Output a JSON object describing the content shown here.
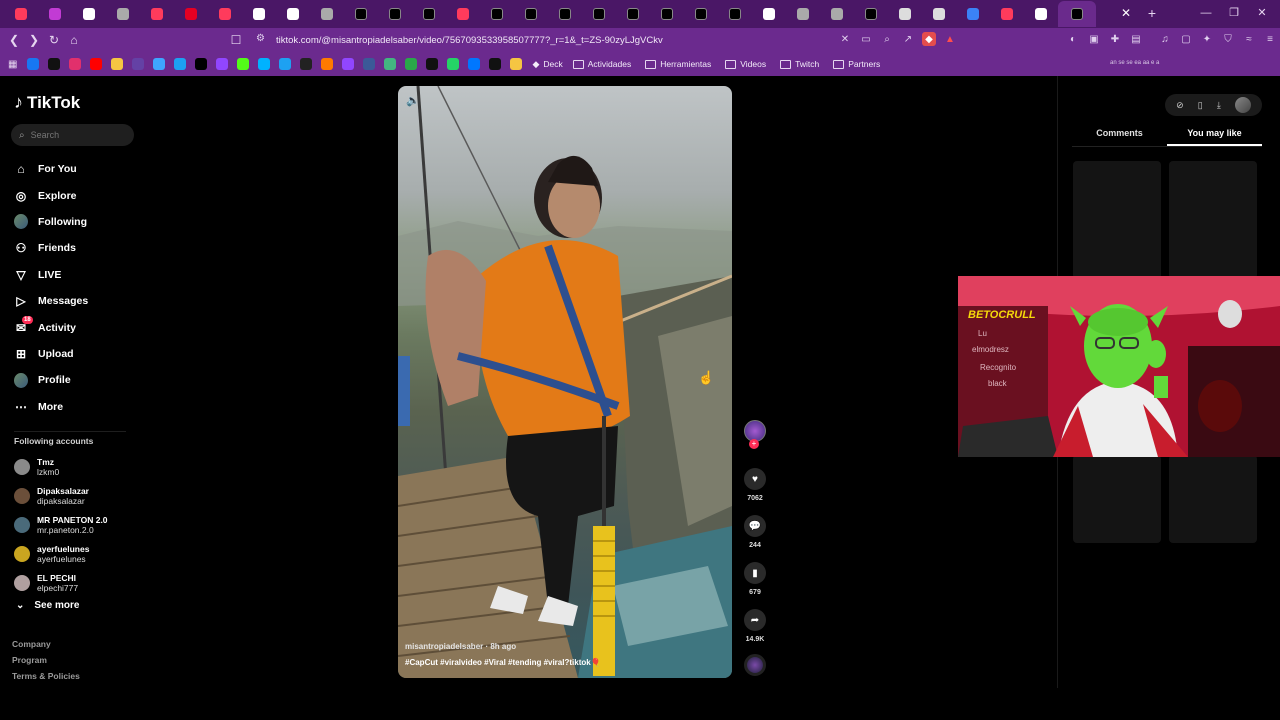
{
  "browser": {
    "url": "tiktok.com/@misantropiadelsaber/video/7567093533958507777?_r=1&_t=ZS-90zyLJgVCkv",
    "tabs": [
      {
        "color": "#ff3b5c",
        "icon": "youtube-icon"
      },
      {
        "color": "#c23bd4",
        "icon": "mail-icon"
      },
      {
        "color": "#ffffff",
        "icon": "chrome-icon"
      },
      {
        "color": "#aaaaaa",
        "icon": "settings-icon"
      },
      {
        "color": "#ff3b5c",
        "icon": "youtube-icon"
      },
      {
        "color": "#e60023",
        "icon": "pinterest-icon"
      },
      {
        "color": "#ff3b5c",
        "icon": "youtube-icon"
      },
      {
        "color": "#ffffff",
        "icon": "chrome-icon"
      },
      {
        "color": "#ffffff",
        "icon": "chrome-icon"
      },
      {
        "color": "#aaaaaa",
        "icon": "settings-icon"
      },
      {
        "color": "#000000",
        "icon": "tiktok-icon"
      },
      {
        "color": "#000000",
        "icon": "tiktok-icon"
      },
      {
        "color": "#000000",
        "icon": "tiktok-icon"
      },
      {
        "color": "#ff3b5c",
        "icon": "youtube-icon"
      },
      {
        "color": "#000000",
        "icon": "tiktok-icon"
      },
      {
        "color": "#000000",
        "icon": "tiktok-icon"
      },
      {
        "color": "#000000",
        "icon": "tiktok-icon"
      },
      {
        "color": "#000000",
        "icon": "tiktok-icon"
      },
      {
        "color": "#000000",
        "icon": "tiktok-icon"
      },
      {
        "color": "#000000",
        "icon": "tiktok-icon"
      },
      {
        "color": "#000000",
        "icon": "tiktok-icon"
      },
      {
        "color": "#000000",
        "icon": "tiktok-icon"
      },
      {
        "color": "#ffffff",
        "icon": "chrome-icon"
      },
      {
        "color": "#aaaaaa",
        "icon": "settings-icon"
      },
      {
        "color": "#aaaaaa",
        "icon": "settings-icon"
      },
      {
        "color": "#000000",
        "icon": "tiktok-icon"
      },
      {
        "color": "#dddddd",
        "icon": "page-icon"
      },
      {
        "color": "#dddddd",
        "icon": "page-icon"
      },
      {
        "color": "#3b82f6",
        "icon": "check-icon"
      },
      {
        "color": "#ff3b5c",
        "icon": "youtube-icon"
      },
      {
        "color": "#ffffff",
        "icon": "chrome-icon"
      },
      {
        "color": "#000000",
        "icon": "tiktok-icon"
      }
    ],
    "bookmarks": {
      "icons": [
        "#1877f2",
        "#111111",
        "#e1306c",
        "#ff0000",
        "#f5c542",
        "#6441a5",
        "#3ea6ff",
        "#1da1f2",
        "#000000",
        "#9146ff",
        "#53fc18",
        "#00b2ff",
        "#1da1f2",
        "#222222",
        "#ff7a00",
        "#9146ff",
        "#3b5998",
        "#43b581",
        "#2aa84a",
        "#111111",
        "#25d366",
        "#0077ff",
        "#111111",
        "#f5c542"
      ],
      "deck": "Deck",
      "folders": [
        "Actividades",
        "Herramientas",
        "Videos",
        "Twitch",
        "Partners"
      ],
      "status": "an se se ea aa e a"
    }
  },
  "sidebar": {
    "logo": "TikTok",
    "search_placeholder": "Search",
    "nav": [
      {
        "label": "For You",
        "icon": "home-icon"
      },
      {
        "label": "Explore",
        "icon": "compass-icon"
      },
      {
        "label": "Following",
        "icon": "avatar-icon"
      },
      {
        "label": "Friends",
        "icon": "friends-icon"
      },
      {
        "label": "LIVE",
        "icon": "live-icon"
      },
      {
        "label": "Messages",
        "icon": "messages-icon"
      },
      {
        "label": "Activity",
        "icon": "activity-icon",
        "badge": "18"
      },
      {
        "label": "Upload",
        "icon": "upload-icon"
      },
      {
        "label": "Profile",
        "icon": "profile-icon"
      },
      {
        "label": "More",
        "icon": "more-icon"
      }
    ],
    "following_title": "Following accounts",
    "accounts": [
      {
        "name": "Tmz",
        "user": "lzkm0",
        "color": "#8a8a8a"
      },
      {
        "name": "Dipaksalazar",
        "user": "dipaksalazar",
        "color": "#6b4f3a"
      },
      {
        "name": "MR PANETON 2.0",
        "user": "mr.paneton.2.0",
        "color": "#4a6a7a"
      },
      {
        "name": "ayerfuelunes",
        "user": "ayerfuelunes",
        "color": "#c9a520"
      },
      {
        "name": "EL PECHI",
        "user": "elpechi777",
        "color": "#b0a0a0"
      }
    ],
    "see_more": "See more",
    "footer": [
      "Company",
      "Program",
      "Terms & Policies"
    ]
  },
  "video": {
    "author": "misantropiadelsaber",
    "time": "8h ago",
    "meta_sep": " · ",
    "hashtags": "#CapCut #viralvideo #Viral #tending #viral?tiktok🎈",
    "likes": "7062",
    "comments": "244",
    "saves": "679",
    "shares": "14.9K"
  },
  "right_panel": {
    "tabs": [
      "Comments",
      "You may like"
    ],
    "selected_tab": "You may like"
  },
  "webcam": {
    "overlay_text": "BETOCRULL"
  }
}
